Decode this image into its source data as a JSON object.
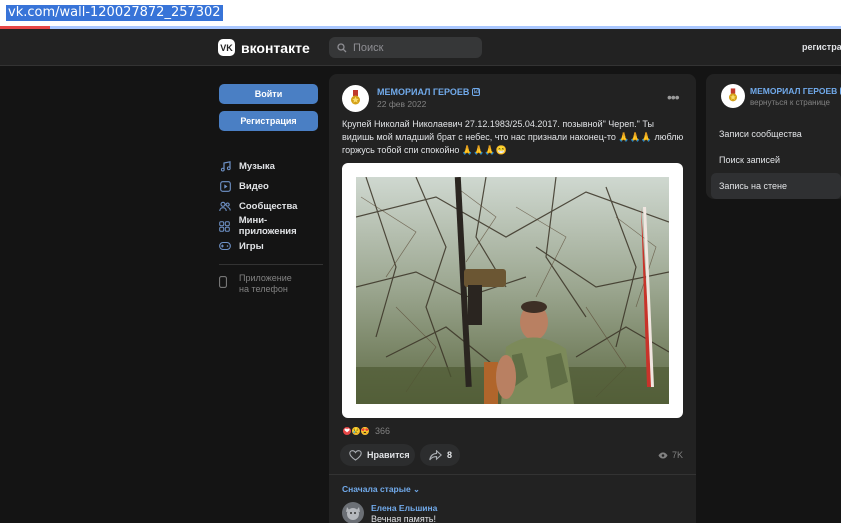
{
  "browser": {
    "url": "vk.com/wall-120027872_257302",
    "load_progress": 0.06
  },
  "header": {
    "logo_icon": "VK",
    "logo_text": "вконтакте",
    "search_placeholder": "Поиск",
    "register_link": "регистрация"
  },
  "sidebar": {
    "login_button": "Войти",
    "register_button": "Регистрация",
    "items": [
      {
        "label": "Музыка",
        "icon": "music-icon"
      },
      {
        "label": "Видео",
        "icon": "video-icon"
      },
      {
        "label": "Сообщества",
        "icon": "communities-icon"
      },
      {
        "label": "Мини-приложения",
        "icon": "mini-apps-icon"
      },
      {
        "label": "Игры",
        "icon": "games-icon"
      }
    ],
    "app_line1": "Приложение",
    "app_line2": "на телефон"
  },
  "post": {
    "author": "МЕМОРИАЛ ГЕРОЕВ",
    "verified_mark": "☑",
    "date": "22 фев 2022",
    "more": "•••",
    "text": "Крупей Николай Николаевич 27.12.1983/25.04.2017. позывной\" Череп.\" Ты видишь мой младший брат с небес, что нас признали наконец-то 🙏🙏🙏 люблю горжусь тобой спи спокойно 🙏🙏🙏😁",
    "reactions": {
      "emojis": [
        "❤",
        "😢",
        "😍"
      ],
      "count": "366"
    },
    "like_label": "Нравится",
    "share_count": "8",
    "views": "7K"
  },
  "comments": {
    "show_older": "Сначала старые",
    "items": [
      {
        "author": "Елена Ельшина",
        "text": "Вечная память!"
      }
    ]
  },
  "right_card": {
    "name": "МЕМОРИАЛ ГЕРОЕВ",
    "verified_mark": "☑",
    "back_link": "вернуться к странице",
    "menu": [
      {
        "label": "Записи сообщества",
        "active": false
      },
      {
        "label": "Поиск записей",
        "active": false
      },
      {
        "label": "Запись на стене",
        "active": true
      }
    ]
  },
  "colors": {
    "background": "#141414",
    "card": "#222222",
    "accent": "#71aaeb",
    "button": "#4a7fc4"
  }
}
